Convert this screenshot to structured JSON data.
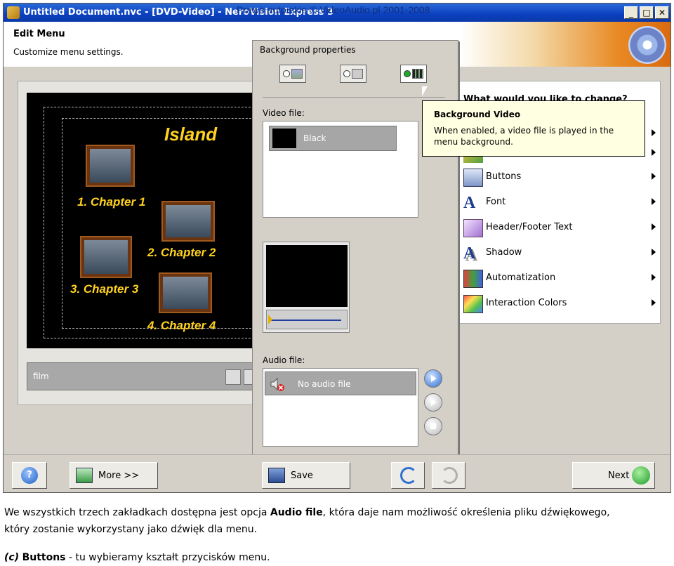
{
  "window": {
    "title": "Untitled Document.nvc - [DVD-Video] - NeroVision Express 3",
    "watermark": "Prawa autorskie © VideoAudio.pl 2001-2008",
    "minimize_glyph": "_",
    "maximize_glyph": "□",
    "close_glyph": "✕"
  },
  "header": {
    "title": "Edit Menu",
    "subtitle": "Customize menu settings."
  },
  "preview": {
    "menu_title": "Island",
    "chapters": [
      "1. Chapter 1",
      "2. Chapter 2",
      "3. Chapter 3",
      "4. Chapter 4"
    ],
    "bar_label": "film"
  },
  "background_properties": {
    "title": "Background properties",
    "video_label": "Video file:",
    "video_item": "Black",
    "audio_label": "Audio file:",
    "audio_item": "No audio file"
  },
  "tooltip": {
    "title": "Background Video",
    "text": "When enabled, a video file is played in the menu background."
  },
  "options": {
    "question": "What would you like to change?",
    "items": [
      {
        "label": "Buttons",
        "icon": "buttons-icon"
      },
      {
        "label": "Font",
        "icon": "font-icon"
      },
      {
        "label": "Header/Footer Text",
        "icon": "header-footer-icon"
      },
      {
        "label": "Shadow",
        "icon": "shadow-icon"
      },
      {
        "label": "Automatization",
        "icon": "automatization-icon"
      },
      {
        "label": "Interaction Colors",
        "icon": "interaction-colors-icon"
      }
    ]
  },
  "toolbar": {
    "help_glyph": "?",
    "more_label": "More >>",
    "save_label": "Save",
    "next_label": "Next"
  },
  "caption": {
    "line1_before": "We wszystkich trzech zakładkach dostępna jest opcja ",
    "line1_bold": "Audio file",
    "line1_after": ", która daje nam możliwość określenia pliku dźwiękowego,",
    "line2": "który zostanie wykorzystany jako dźwięk dla menu.",
    "line3_marker": "(c)",
    "line3_bold": "Buttons",
    "line3_after": " - tu wybieramy kształt przycisków menu."
  },
  "colors": {
    "title_bar": "#0b3fbf",
    "menu_text": "#ffd21f",
    "tooltip_bg": "#ffffe1",
    "accent_blue": "#2f6fd1"
  }
}
